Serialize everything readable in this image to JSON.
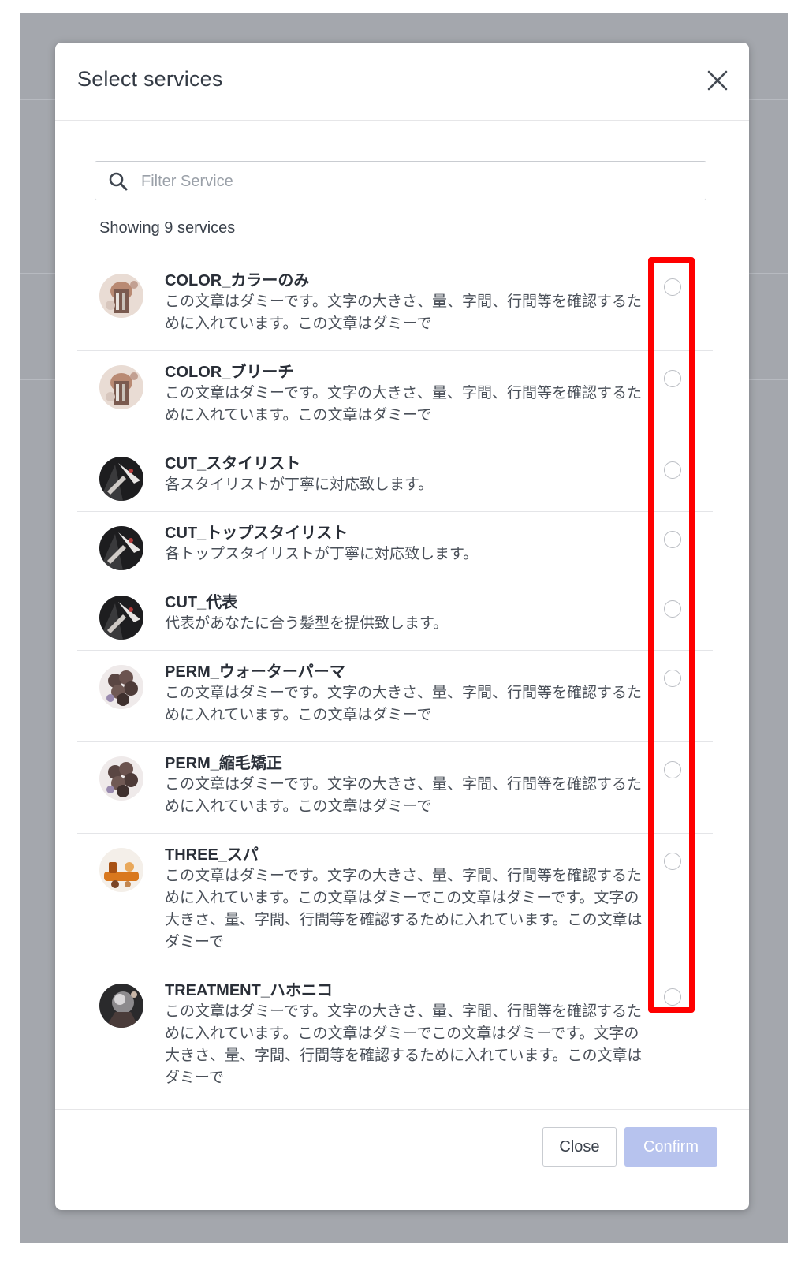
{
  "modal": {
    "title": "Select services",
    "close_icon": "close-icon"
  },
  "search": {
    "placeholder": "Filter Service",
    "value": "",
    "icon": "search-icon"
  },
  "count_text": "Showing 9 services",
  "services": [
    {
      "name": "COLOR_カラーのみ",
      "description": "この文章はダミーです。文字の大きさ、量、字間、行間等を確認するために入れています。この文章はダミーで",
      "avatar": "hair-color-photo",
      "selected": false
    },
    {
      "name": "COLOR_ブリーチ",
      "description": "この文章はダミーです。文字の大きさ、量、字間、行間等を確認するために入れています。この文章はダミーで",
      "avatar": "hair-color-photo",
      "selected": false
    },
    {
      "name": "CUT_スタイリスト",
      "description": "各スタイリストが丁寧に対応致します。",
      "avatar": "haircut-photo",
      "selected": false
    },
    {
      "name": "CUT_トップスタイリスト",
      "description": "各トップスタイリストが丁寧に対応致します。",
      "avatar": "haircut-photo",
      "selected": false
    },
    {
      "name": "CUT_代表",
      "description": "代表があなたに合う髪型を提供致します。",
      "avatar": "haircut-photo",
      "selected": false
    },
    {
      "name": "PERM_ウォーターパーマ",
      "description": "この文章はダミーです。文字の大きさ、量、字間、行間等を確認するために入れています。この文章はダミーで",
      "avatar": "perm-photo",
      "selected": false
    },
    {
      "name": "PERM_縮毛矯正",
      "description": "この文章はダミーです。文字の大きさ、量、字間、行間等を確認するために入れています。この文章はダミーで",
      "avatar": "perm-photo",
      "selected": false
    },
    {
      "name": "THREE_スパ",
      "description": "この文章はダミーです。文字の大きさ、量、字間、行間等を確認するために入れています。この文章はダミーでこの文章はダミーです。文字の大きさ、量、字間、行間等を確認するために入れています。この文章はダミーで",
      "avatar": "spa-photo",
      "selected": false
    },
    {
      "name": "TREATMENT_ハホニコ",
      "description": "この文章はダミーです。文字の大きさ、量、字間、行間等を確認するために入れています。この文章はダミーでこの文章はダミーです。文字の大きさ、量、字間、行間等を確認するために入れています。この文章はダミーで",
      "avatar": "treatment-photo",
      "selected": false
    }
  ],
  "footer": {
    "close_label": "Close",
    "confirm_label": "Confirm"
  },
  "colors": {
    "highlight": "#ff0000",
    "confirm_disabled": "#b7c3ee",
    "backdrop": "#a4a7ad"
  }
}
